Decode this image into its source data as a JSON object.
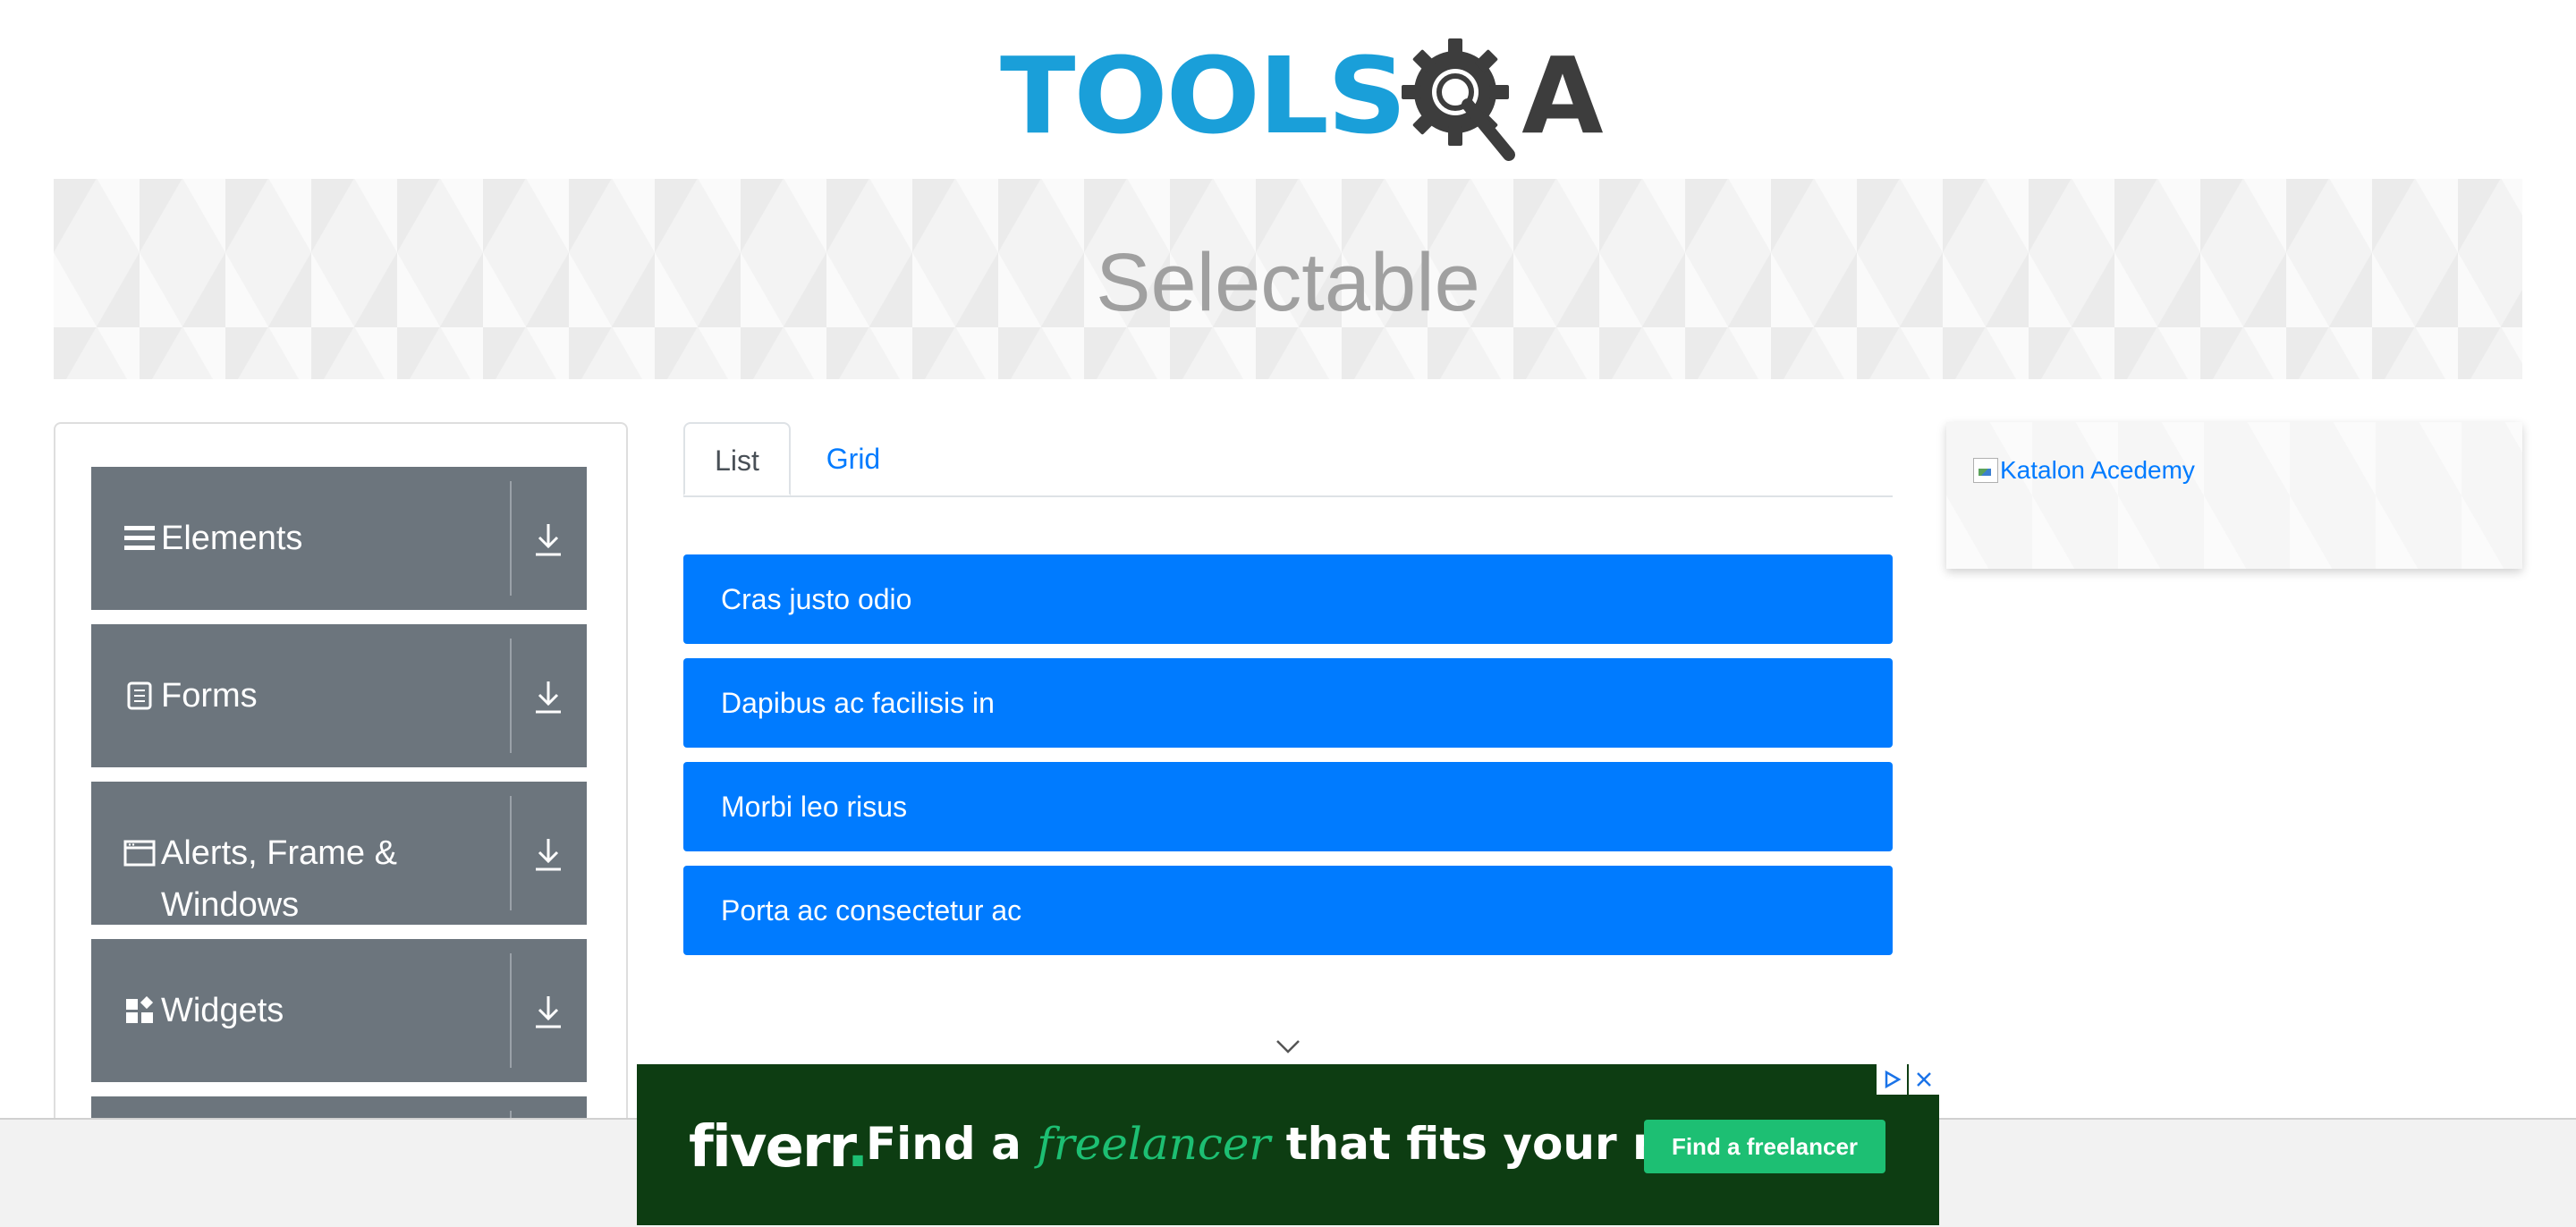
{
  "header": {
    "logo_text_primary": "TOOLS",
    "logo_text_secondary": "A",
    "logo_icon": "gear-magnifier-icon"
  },
  "banner": {
    "title": "Selectable"
  },
  "sidebar": {
    "groups": [
      {
        "label": "Elements",
        "icon": "hamburger-icon"
      },
      {
        "label": "Forms",
        "icon": "document-icon"
      },
      {
        "label": "Alerts, Frame & Windows",
        "icon": "window-icon"
      },
      {
        "label": "Widgets",
        "icon": "widgets-icon"
      }
    ],
    "expand_icon": "download-arrow-icon"
  },
  "tabs": [
    {
      "label": "List",
      "active": true
    },
    {
      "label": "Grid",
      "active": false
    }
  ],
  "list_items": [
    "Cras justo odio",
    "Dapibus ac facilisis in",
    "Morbi leo risus",
    "Porta ac consectetur ac"
  ],
  "ad_card": {
    "alt_text": "Katalon Acedemy"
  },
  "fiverr_ad": {
    "logo": "fiverr",
    "logo_dot": ".",
    "tagline_before": "Find a ",
    "tagline_emphasis": "freelancer",
    "tagline_after": " that fits your needs",
    "cta_label": "Find a freelancer"
  },
  "colors": {
    "primary": "#007bff",
    "sidebar_group": "#6c757d",
    "logo_blue": "#1a9fd9",
    "logo_dark": "#3d3d3d",
    "fiverr_bg": "#0d3d12",
    "fiverr_green": "#1dbf73"
  }
}
